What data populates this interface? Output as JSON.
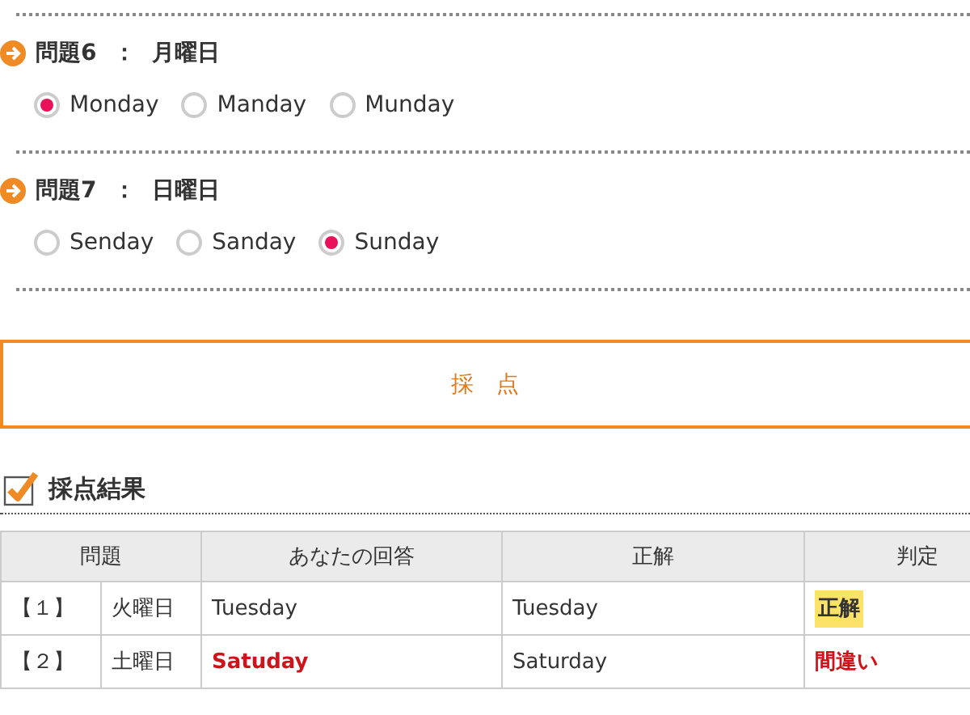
{
  "questions": [
    {
      "number": "問題6",
      "separator": "：",
      "prompt": "月曜日",
      "options": [
        {
          "label": "Monday",
          "selected": true
        },
        {
          "label": "Manday",
          "selected": false
        },
        {
          "label": "Munday",
          "selected": false
        }
      ]
    },
    {
      "number": "問題7",
      "separator": "：",
      "prompt": "日曜日",
      "options": [
        {
          "label": "Senday",
          "selected": false
        },
        {
          "label": "Sanday",
          "selected": false
        },
        {
          "label": "Sunday",
          "selected": true
        }
      ]
    }
  ],
  "grade_button": "採　点",
  "results": {
    "title": "採点結果",
    "columns": [
      "問題",
      "あなたの回答",
      "正解",
      "判定"
    ],
    "rows": [
      {
        "index": "【１】",
        "question": "火曜日",
        "answer": "Tuesday",
        "solution": "Tuesday",
        "verdict": "正解",
        "correct": true
      },
      {
        "index": "【２】",
        "question": "土曜日",
        "answer": "Satuday",
        "solution": "Saturday",
        "verdict": "間違い",
        "correct": false
      }
    ]
  }
}
